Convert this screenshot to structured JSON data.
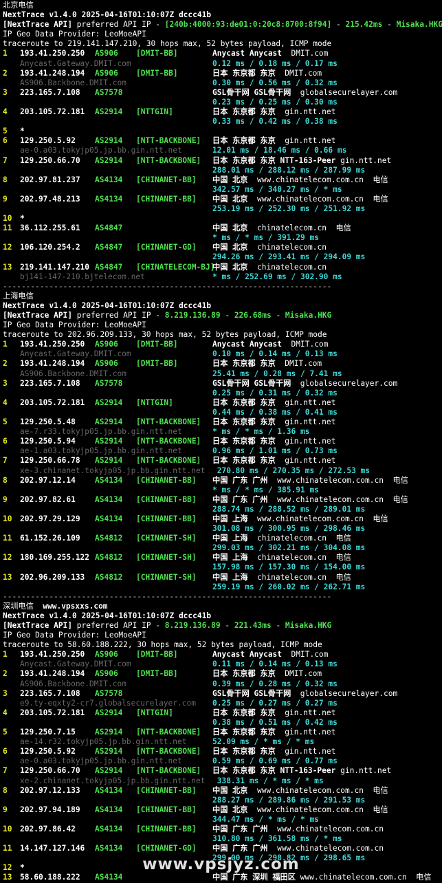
{
  "sections": [
    {
      "title": "北京电信",
      "site": "",
      "app_line": "NextTrace v1.4.0 2025-04-16T01:10:07Z dccc41b",
      "api_prefix": "[NextTrace API]",
      "api_mid": " preferred API IP - ",
      "api_ip": "[240b:4000:93:de01:0:20c8:8700:8f94]",
      "api_dash1": " - ",
      "api_ms": "215.42ms",
      "api_dash2": " - ",
      "api_node": "Misaka.HKG",
      "geo_provider": "IP Geo Data Provider: LeoMoeAPI",
      "traceroute_line": "traceroute to 219.141.147.210, 30 hops max, 52 bytes payload, ICMP mode",
      "hops": [
        {
          "idx": "1",
          "ip": "193.41.250.250",
          "as": "AS906",
          "tag": "[DMIT-BB]",
          "geo": "Anycast Anycast",
          "domain": "  DMIT.com",
          "host": "Anycast.Gateway.DMIT.com",
          "rtt": "0.12 ms / 0.18 ms / 0.17 ms"
        },
        {
          "idx": "2",
          "ip": "193.41.248.194",
          "as": "AS906",
          "tag": "[DMIT-BB]",
          "geo": "日本 东京都 东京",
          "domain": "  DMIT.com",
          "host": "AS906.Backbone.DMIT.com",
          "rtt": "0.30 ms / 0.56 ms / 0.32 ms"
        },
        {
          "idx": "3",
          "ip": "223.165.7.108",
          "as": "AS7578",
          "tag": "",
          "geo": "GSL骨干网 GSL骨干网",
          "domain": "  globalsecurelayer.com",
          "host": "",
          "rtt": "0.23 ms / 0.25 ms / 0.30 ms"
        },
        {
          "idx": "4",
          "ip": "203.105.72.181",
          "as": "AS2914",
          "tag": "[NTTGIN]",
          "geo": "日本 东京都 东京",
          "domain": "  gin.ntt.net",
          "host": "",
          "rtt": "0.33 ms / 0.42 ms / 0.38 ms"
        },
        {
          "idx": "5",
          "ip": "*",
          "as": "",
          "tag": "",
          "geo": "",
          "domain": "",
          "host": "",
          "rtt": ""
        },
        {
          "idx": "6",
          "ip": "129.250.5.92",
          "as": "AS2914",
          "tag": "[NTT-BACKBONE]",
          "geo": "日本 东京都 东京",
          "domain": "  gin.ntt.net",
          "host": "ae-0.a03.tokyjp05.jp.bb.gin.ntt.net",
          "rtt": "12.01 ms / 18.46 ms / 0.66 ms"
        },
        {
          "idx": "7",
          "ip": "129.250.66.70",
          "as": "AS2914",
          "tag": "[NTT-BACKBONE]",
          "geo": "日本 东京都 东京 NTT-163-Peer",
          "domain": " gin.ntt.net",
          "host": "",
          "rtt": "288.01 ms / 288.12 ms / 287.99 ms"
        },
        {
          "idx": "8",
          "ip": "202.97.81.237",
          "as": "AS4134",
          "tag": "[CHINANET-BB]",
          "geo": "中国 北京",
          "domain": "  www.chinatelecom.com.cn  电信",
          "host": "",
          "rtt": "342.57 ms / 340.27 ms / * ms"
        },
        {
          "idx": "9",
          "ip": "202.97.48.213",
          "as": "AS4134",
          "tag": "[CHINANET-BB]",
          "geo": "中国 北京",
          "domain": "  www.chinatelecom.com.cn  电信",
          "host": "",
          "rtt": "253.19 ms / 252.30 ms / 251.92 ms"
        },
        {
          "idx": "10",
          "ip": "*",
          "as": "",
          "tag": "",
          "geo": "",
          "domain": "",
          "host": "",
          "rtt": ""
        },
        {
          "idx": "11",
          "ip": "36.112.255.61",
          "as": "AS4847",
          "tag": "",
          "geo": "中国 北京",
          "domain": "  chinatelecom.cn  电信",
          "host": "",
          "rtt": "* ms / * ms / 391.29 ms"
        },
        {
          "idx": "12",
          "ip": "106.120.254.2",
          "as": "AS4847",
          "tag": "[CHINANET-GD]",
          "geo": "中国 北京",
          "domain": "  chinatelecom.cn",
          "host": "",
          "rtt": "294.26 ms / 293.41 ms / 294.09 ms"
        },
        {
          "idx": "13",
          "ip": "219.141.147.210",
          "as": "AS4847",
          "tag": "[CHINATELECOM-BJ]",
          "geo": "中国 北京",
          "domain": "  chinatelecom.cn",
          "host": "bj141-147-210.bjtelecom.net",
          "rtt": "* ms / 252.69 ms / 302.90 ms"
        }
      ]
    },
    {
      "title": "上海电信",
      "site": "",
      "app_line": "NextTrace v1.4.0 2025-04-16T01:10:07Z dccc41b",
      "api_prefix": "[NextTrace API]",
      "api_mid": " preferred API IP - ",
      "api_ip": "8.219.136.89",
      "api_dash1": " - ",
      "api_ms": "226.68ms",
      "api_dash2": " - ",
      "api_node": "Misaka.HKG",
      "geo_provider": "IP Geo Data Provider: LeoMoeAPI",
      "traceroute_line": "traceroute to 202.96.209.133, 30 hops max, 52 bytes payload, ICMP mode",
      "hops": [
        {
          "idx": "1",
          "ip": "193.41.250.250",
          "as": "AS906",
          "tag": "[DMIT-BB]",
          "geo": "Anycast Anycast",
          "domain": "  DMIT.com",
          "host": "Anycast.Gateway.DMIT.com",
          "rtt": "0.10 ms / 0.14 ms / 0.13 ms"
        },
        {
          "idx": "2",
          "ip": "193.41.248.194",
          "as": "AS906",
          "tag": "[DMIT-BB]",
          "geo": "日本 东京都 东京",
          "domain": "  DMIT.com",
          "host": "AS906.Backbone.DMIT.com",
          "rtt": "25.41 ms / 0.28 ms / 7.41 ms"
        },
        {
          "idx": "3",
          "ip": "223.165.7.108",
          "as": "AS7578",
          "tag": "",
          "geo": "GSL骨干网 GSL骨干网",
          "domain": "  globalsecurelayer.com",
          "host": "",
          "rtt": "0.25 ms / 0.31 ms / 0.32 ms"
        },
        {
          "idx": "4",
          "ip": "203.105.72.181",
          "as": "AS2914",
          "tag": "[NTTGIN]",
          "geo": "日本 东京都 东京",
          "domain": "  gin.ntt.net",
          "host": "",
          "rtt": "0.44 ms / 0.38 ms / 0.41 ms"
        },
        {
          "idx": "5",
          "ip": "129.250.5.48",
          "as": "AS2914",
          "tag": "[NTT-BACKBONE]",
          "geo": "日本 东京都 东京",
          "domain": "  gin.ntt.net",
          "host": "ae-7.r33.tokyjp05.jp.bb.gin.ntt.net",
          "rtt": "* ms / * ms / 1.36 ms"
        },
        {
          "idx": "6",
          "ip": "129.250.5.94",
          "as": "AS2914",
          "tag": "[NTT-BACKBONE]",
          "geo": "日本 东京都 东京",
          "domain": "  gin.ntt.net",
          "host": "ae-1.a03.tokyjp05.jp.bb.gin.ntt.net",
          "rtt": "0.96 ms / 1.01 ms / 0.73 ms"
        },
        {
          "idx": "7",
          "ip": "129.250.66.78",
          "as": "AS2914",
          "tag": "[NTT-BACKBONE]",
          "geo": "日本 东京都 东京",
          "domain": "  gin.ntt.net",
          "host": "xe-3.chinanet.tokyjp05.jp.bb.gin.ntt.net",
          "rtt": " 270.80 ms / 270.35 ms / 272.53 ms"
        },
        {
          "idx": "8",
          "ip": "202.97.12.14",
          "as": "AS4134",
          "tag": "[CHINANET-BB]",
          "geo": "中国 广东 广州",
          "domain": "  www.chinatelecom.com.cn  电信",
          "host": "",
          "rtt": "* ms / * ms / 385.91 ms"
        },
        {
          "idx": "9",
          "ip": "202.97.82.61",
          "as": "AS4134",
          "tag": "[CHINANET-BB]",
          "geo": "中国 广东 广州",
          "domain": "  www.chinatelecom.com.cn  电信",
          "host": "",
          "rtt": "288.74 ms / 288.52 ms / 289.01 ms"
        },
        {
          "idx": "10",
          "ip": "202.97.29.129",
          "as": "AS4134",
          "tag": "[CHINANET-BB]",
          "geo": "中国 上海",
          "domain": "  www.chinatelecom.com.cn  电信",
          "host": "",
          "rtt": "301.08 ms / 300.95 ms / 298.46 ms"
        },
        {
          "idx": "11",
          "ip": "61.152.26.109",
          "as": "AS4812",
          "tag": "[CHINANET-SH]",
          "geo": "中国 上海",
          "domain": "  chinatelecom.cn  电信",
          "host": "",
          "rtt": "299.03 ms / 302.21 ms / 304.08 ms"
        },
        {
          "idx": "12",
          "ip": "180.169.255.122",
          "as": "AS4812",
          "tag": "[CHINANET-SH]",
          "geo": "中国 上海",
          "domain": "  chinatelecom.cn  电信",
          "host": "",
          "rtt": "157.98 ms / 157.30 ms / 154.00 ms"
        },
        {
          "idx": "13",
          "ip": "202.96.209.133",
          "as": "AS4812",
          "tag": "[CHINANET-SH]",
          "geo": "中国 上海",
          "domain": "  chinatelecom.cn  电信",
          "host": "",
          "rtt": "259.19 ms / 260.02 ms / 262.71 ms"
        }
      ]
    },
    {
      "title": "深圳电信",
      "site": "www.vpsxxs.com",
      "app_line": "NextTrace v1.4.0 2025-04-16T01:10:07Z dccc41b",
      "api_prefix": "[NextTrace API]",
      "api_mid": " preferred API IP - ",
      "api_ip": "8.219.136.89",
      "api_dash1": " - ",
      "api_ms": "221.43ms",
      "api_dash2": " - ",
      "api_node": "Misaka.HKG",
      "geo_provider": "IP Geo Data Provider: LeoMoeAPI",
      "traceroute_line": "traceroute to 58.60.188.222, 30 hops max, 52 bytes payload, ICMP mode",
      "hops": [
        {
          "idx": "1",
          "ip": "193.41.250.250",
          "as": "AS906",
          "tag": "[DMIT-BB]",
          "geo": "Anycast Anycast",
          "domain": "  DMIT.com",
          "host": "Anycast.Gateway.DMIT.com",
          "rtt": "0.11 ms / 0.14 ms / 0.13 ms"
        },
        {
          "idx": "2",
          "ip": "193.41.248.194",
          "as": "AS906",
          "tag": "[DMIT-BB]",
          "geo": "日本 东京都 东京",
          "domain": "  DMIT.com",
          "host": "AS906.Backbone.DMIT.com",
          "rtt": "0.39 ms / 0.28 ms / 0.32 ms"
        },
        {
          "idx": "3",
          "ip": "223.165.7.108",
          "as": "AS7578",
          "tag": "",
          "geo": "GSL骨干网 GSL骨干网",
          "domain": "  globalsecurelayer.com",
          "host": "e9.ty-eqxty2-cr7.globalsecurelayer.com",
          "rtt": "0.25 ms / 0.27 ms / 0.27 ms"
        },
        {
          "idx": "4",
          "ip": "203.105.72.181",
          "as": "AS2914",
          "tag": "[NTTGIN]",
          "geo": "日本 东京都 东京",
          "domain": "  gin.ntt.net",
          "host": "",
          "rtt": "0.38 ms / 0.51 ms / 0.42 ms"
        },
        {
          "idx": "5",
          "ip": "129.250.7.15",
          "as": "AS2914",
          "tag": "[NTT-BACKBONE]",
          "geo": "日本 东京都 东京",
          "domain": "  gin.ntt.net",
          "host": "ae-14.r32.tokyjp05.jp.bb.gin.ntt.net",
          "rtt": "52.09 ms / * ms / * ms"
        },
        {
          "idx": "6",
          "ip": "129.250.5.92",
          "as": "AS2914",
          "tag": "[NTT-BACKBONE]",
          "geo": "日本 东京都 东京",
          "domain": "  gin.ntt.net",
          "host": "ae-0.a03.tokyjp05.jp.bb.gin.ntt.net",
          "rtt": "0.59 ms / 0.69 ms / 0.77 ms"
        },
        {
          "idx": "7",
          "ip": "129.250.66.70",
          "as": "AS2914",
          "tag": "[NTT-BACKBONE]",
          "geo": "日本 东京都 东京 NTT-163-Peer",
          "domain": " gin.ntt.net",
          "host": "xe-2.chinanet.tokyjp05.jp.bb.gin.ntt.net",
          "rtt": " 338.31 ms / * ms / * ms"
        },
        {
          "idx": "8",
          "ip": "202.97.12.133",
          "as": "AS4134",
          "tag": "[CHINANET-BB]",
          "geo": "中国 北京",
          "domain": "  www.chinatelecom.com.cn  电信",
          "host": "",
          "rtt": "288.27 ms / 289.86 ms / 291.53 ms"
        },
        {
          "idx": "9",
          "ip": "202.97.94.189",
          "as": "AS4134",
          "tag": "[CHINANET-BB]",
          "geo": "中国 北京",
          "domain": "  www.chinatelecom.com.cn  电信",
          "host": "",
          "rtt": "344.47 ms / * ms / * ms"
        },
        {
          "idx": "10",
          "ip": "202.97.86.42",
          "as": "AS4134",
          "tag": "[CHINANET-BB]",
          "geo": "中国 广东 广州",
          "domain": "  www.chinatelecom.com.cn",
          "host": "",
          "rtt": "310.80 ms / 361.58 ms / * ms"
        },
        {
          "idx": "11",
          "ip": "14.147.127.146",
          "as": "AS4134",
          "tag": "[CHINANET-GD]",
          "geo": "中国 广东 广州",
          "domain": "  www.chinatelecom.com.cn",
          "host": "",
          "rtt": "299.00 ms / 298.82 ms / 298.65 ms"
        },
        {
          "idx": "12",
          "ip": "*",
          "as": "",
          "tag": "",
          "geo": "",
          "domain": "",
          "host": "",
          "rtt": ""
        },
        {
          "idx": "13",
          "ip": "58.60.188.222",
          "as": "AS4134",
          "tag": "",
          "geo": "中国 广东 深圳 福田区",
          "domain": " www.chinatelecom.com.cn  电信",
          "host": "",
          "rtt": ""
        }
      ]
    }
  ],
  "separator": "-----------------------------------------------------------------------",
  "watermark": "www.vpsjyz.com"
}
